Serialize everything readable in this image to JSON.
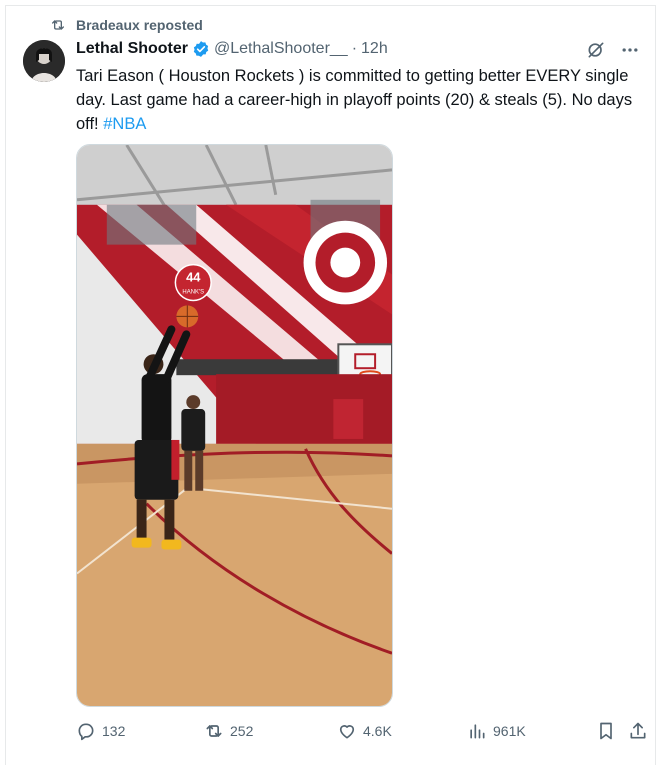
{
  "repost": {
    "text": "Bradeaux reposted",
    "icon": "repost-icon"
  },
  "author": {
    "name": "Lethal Shooter",
    "handle": "@LethalShooter__",
    "separator": "·",
    "time": "12h",
    "verified": true
  },
  "tweet": {
    "text": "Tari Eason ( Houston Rockets ) is committed to getting better EVERY single day. Last game had a career-high in playoff points (20) & steals (5). No days off!",
    "hashtag": "#NBA"
  },
  "media": {
    "description": "video of basketball player shooting in gym",
    "banner_number": "44",
    "banner_text": "HANK'S"
  },
  "stats": {
    "replies": "132",
    "reposts": "252",
    "likes": "4.6K",
    "views": "961K"
  },
  "colors": {
    "accent": "#1d9bf0",
    "muted": "#536471",
    "text": "#0f1419",
    "court_red": "#b0202a"
  }
}
